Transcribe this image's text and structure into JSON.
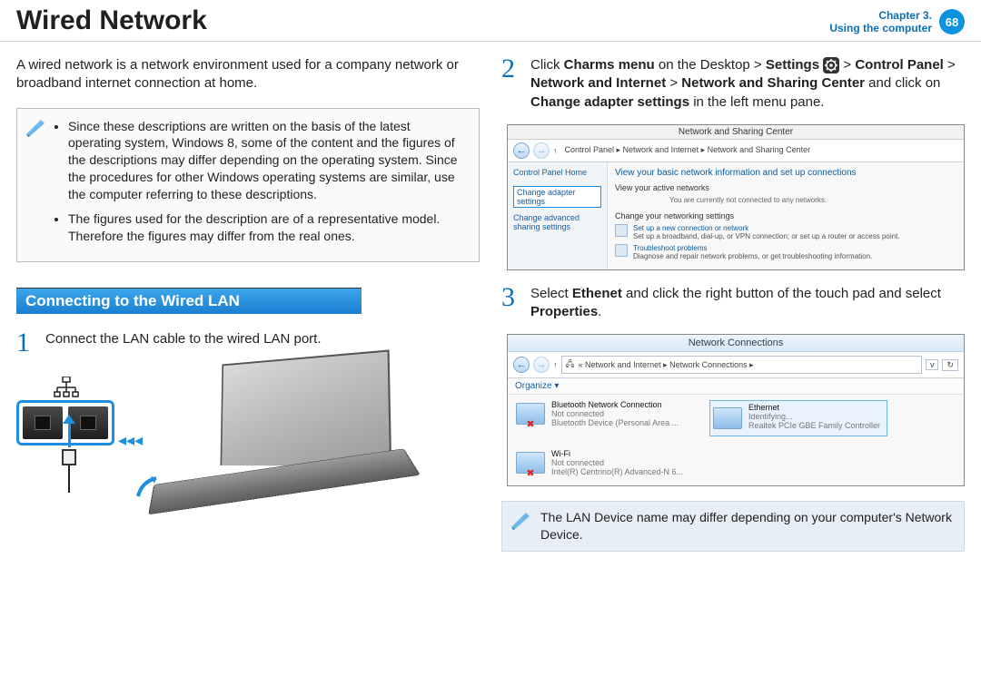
{
  "header": {
    "title": "Wired Network",
    "chapter_line1": "Chapter 3.",
    "chapter_line2": "Using the computer",
    "page_number": "68"
  },
  "intro": "A wired network is a network environment used for a company network or broadband internet connection at home.",
  "notes": [
    "Since these descriptions are written on the basis of the latest operating system, Windows 8, some of the content and the figures of the descriptions may differ depending on the operating system. Since the procedures for other Windows operating systems are similar, use the computer referring to these descriptions.",
    "The figures used for the description are of a representative model. Therefore the figures may differ from the real ones."
  ],
  "section_heading": "Connecting to the Wired LAN",
  "steps": {
    "s1": {
      "num": "1",
      "text": "Connect the LAN cable to the wired LAN port."
    },
    "s2": {
      "num": "2",
      "pre": "Click ",
      "b1": "Charms menu",
      "mid1": " on the Desktop > ",
      "b2": "Settings",
      "gt": " > ",
      "b3": "Control Panel",
      "gt2": " > ",
      "b4": "Network and Internet",
      "gt3": " > ",
      "b5": "Network and Sharing Center",
      "mid2": " and click on ",
      "b6": "Change adapter settings",
      "tail": " in the left menu pane."
    },
    "s3": {
      "num": "3",
      "pre": "Select ",
      "b1": "Ethenet",
      "mid": " and click the right button of the touch pad and select ",
      "b2": "Properties",
      "tail": "."
    }
  },
  "nsc": {
    "title": "Network and Sharing Center",
    "breadcrumb": "Control Panel  ▸  Network and Internet  ▸  Network and Sharing Center",
    "side": {
      "home": "Control Panel Home",
      "change_adapter": "Change adapter settings",
      "change_advanced": "Change advanced sharing settings"
    },
    "main": {
      "h1": "View your basic network information and set up connections",
      "active": "View your active networks",
      "active_sub": "You are currently not connected to any networks.",
      "change_hdr": "Change your networking settings",
      "row1_link": "Set up a new connection or network",
      "row1_desc": "Set up a broadband, dial-up, or VPN connection; or set up a router or access point.",
      "row2_link": "Troubleshoot problems",
      "row2_desc": "Diagnose and repair network problems, or get troubleshooting information."
    }
  },
  "nc": {
    "title": "Network Connections",
    "breadcrumb": "«  Network and Internet  ▸  Network Connections  ▸",
    "organize": "Organize ▾",
    "items": [
      {
        "name": "Bluetooth Network Connection",
        "status": "Not connected",
        "device": "Bluetooth Device (Personal Area ...",
        "cross": true
      },
      {
        "name": "Ethernet",
        "status": "Identifying...",
        "device": "Realtek PCIe GBE Family Controller",
        "selected": true
      },
      {
        "name": "Wi-Fi",
        "status": "Not connected",
        "device": "Intel(R) Centrino(R) Advanced-N 6...",
        "cross": true
      }
    ]
  },
  "device_note": "The LAN Device name may differ depending on your computer's Network Device."
}
